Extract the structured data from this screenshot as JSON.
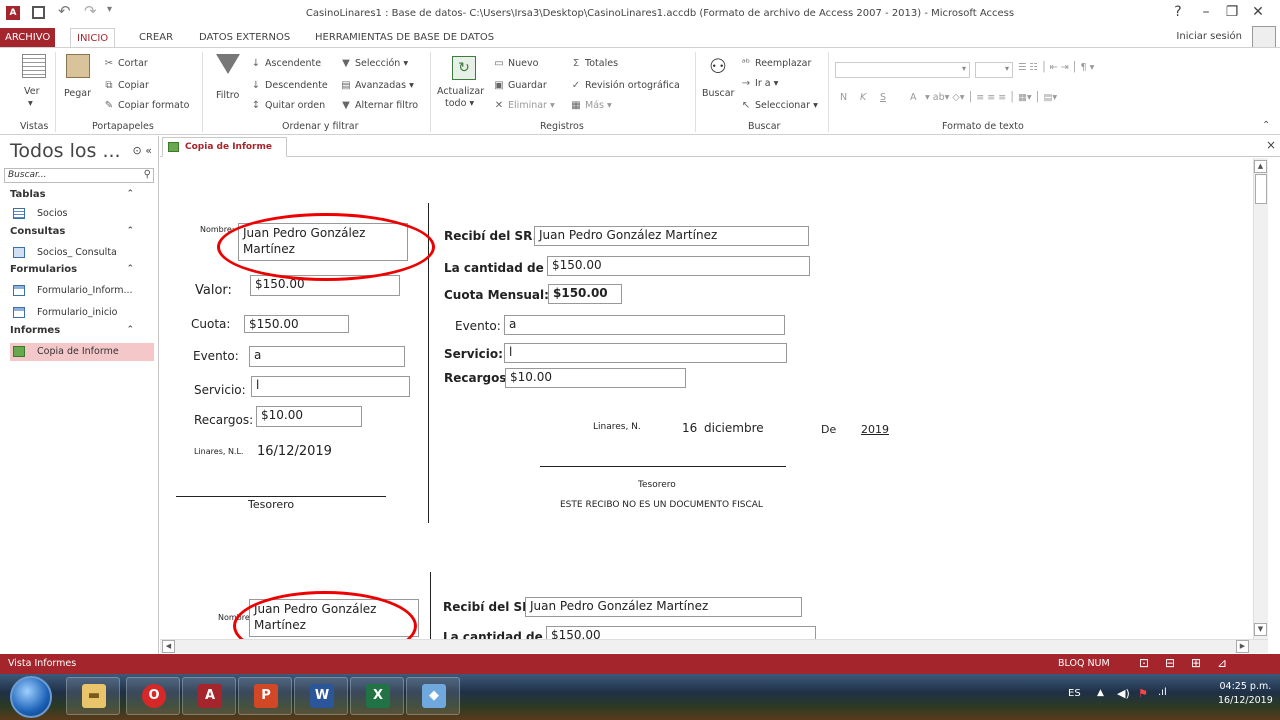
{
  "window": {
    "title": "CasinoLinares1 : Base de datos- C:\\Users\\Irsa3\\Desktop\\CasinoLinares1.accdb (Formato de archivo de Access 2007 - 2013) - Microsoft Access",
    "help": "?",
    "minimize": "–",
    "restore": "❐",
    "close": "✕"
  },
  "tabs": [
    "ARCHIVO",
    "INICIO",
    "CREAR",
    "DATOS EXTERNOS",
    "HERRAMIENTAS DE BASE DE DATOS"
  ],
  "signin": "Iniciar sesión",
  "ribbon": {
    "vistas": {
      "label": "Vistas",
      "ver": "Ver"
    },
    "portapapeles": {
      "label": "Portapapeles",
      "pegar": "Pegar",
      "cortar": "Cortar",
      "copiar": "Copiar",
      "copiar_formato": "Copiar formato"
    },
    "ordenar": {
      "label": "Ordenar y filtrar",
      "filtro": "Filtro",
      "ascendente": "Ascendente",
      "descendente": "Descendente",
      "quitar_orden": "Quitar orden",
      "seleccion": "Selección",
      "avanzadas": "Avanzadas",
      "alternar_filtro": "Alternar filtro"
    },
    "registros": {
      "label": "Registros",
      "actualizar": "Actualizar",
      "todo": "todo",
      "nuevo": "Nuevo",
      "guardar": "Guardar",
      "eliminar": "Eliminar",
      "totales": "Totales",
      "revision": "Revisión ortográfica",
      "mas": "Más"
    },
    "buscar": {
      "label": "Buscar",
      "buscar": "Buscar",
      "reemplazar": "Reemplazar",
      "ir_a": "Ir a",
      "seleccionar": "Seleccionar"
    },
    "formato": {
      "label": "Formato de texto",
      "bold": "N",
      "italic": "K",
      "underline": "S",
      "font_color": "A"
    }
  },
  "doc_tab": {
    "label": "Copia de Informe",
    "close": "×"
  },
  "nav": {
    "header": "Todos los ...",
    "search_placeholder": "Buscar...",
    "categories": [
      {
        "name": "Tablas",
        "items": [
          "Socios"
        ]
      },
      {
        "name": "Consultas",
        "items": [
          "Socios_ Consulta"
        ]
      },
      {
        "name": "Formularios",
        "items": [
          "Formulario_Inform...",
          "Formulario_inicio"
        ]
      },
      {
        "name": "Informes",
        "items": [
          "Copia de Informe"
        ]
      }
    ]
  },
  "report": {
    "nombre_label": "Nombre:",
    "nombre_value_line1": "Juan Pedro González",
    "nombre_value_line2": "Martínez",
    "valor_label": "Valor:",
    "valor_value": "$150.00",
    "cuota_label": "Cuota:",
    "cuota_value": "$150.00",
    "evento_label": "Evento:",
    "evento_value": "a",
    "servicio_label": "Servicio:",
    "servicio_value": "l",
    "recargos_label": "Recargos:",
    "recargos_value": "$10.00",
    "linares_left_label": "Linares, N.L.",
    "fecha_left": "16/12/2019",
    "tesorero_left": "Tesorero",
    "recibi_label": "Recibí del SR.",
    "recibi_value": "Juan Pedro González  Martínez",
    "cantidad_label": "La cantidad de $",
    "cantidad_value": "$150.00",
    "cuota_mensual_label": "Cuota Mensual:",
    "cuota_mensual_value": "$150.00",
    "evento_right_label": "Evento:",
    "evento_right_value": "a",
    "servicio_right_label": "Servicio:",
    "servicio_right_value": "l",
    "recargos_right_label": "Recargos:",
    "recargos_right_value": "$10.00",
    "linares_right_label": "Linares, N.",
    "dia": "16",
    "mes": "diciembre",
    "de_label": "De",
    "anio": "2019",
    "tesorero_right": "Tesorero",
    "fiscal_note": "ESTE RECIBO  NO ES UN DOCUMENTO FISCAL",
    "nombre2_label": "Nombre:",
    "nombre2_value_line1": "Juan Pedro González",
    "nombre2_value_line2": "Martínez",
    "recibi2_label": "Recibí del SR.",
    "recibi2_value": "Juan Pedro González  Martínez",
    "cantidad2_label": "La cantidad de $",
    "cantidad2_value": "$150.00"
  },
  "status": {
    "left": "Vista Informes",
    "bloq": "BLOQ NUM"
  },
  "taskbar": {
    "apps": [
      "explorer-icon",
      "opera-icon",
      "access-icon",
      "powerpoint-icon",
      "word-icon",
      "excel-icon",
      "photos-icon"
    ],
    "lang": "ES",
    "time": "04:25 p.m.",
    "date": "16/12/2019"
  },
  "colors": {
    "accent": "#a4262c",
    "annotation": "#e00000"
  }
}
